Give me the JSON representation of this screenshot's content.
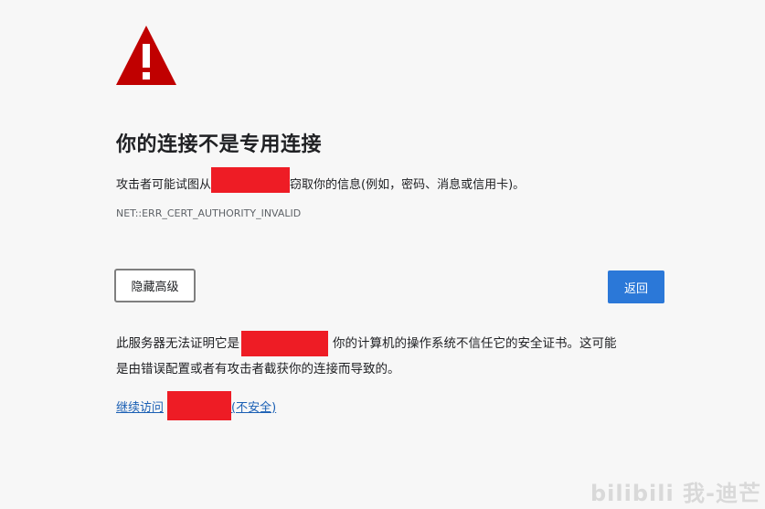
{
  "page": {
    "title": "你的连接不是专用连接",
    "description_before": "攻击者可能试图从",
    "description_after": "窃取你的信息(例如，密码、消息或信用卡)。",
    "error_code": "NET::ERR_CERT_AUTHORITY_INVALID",
    "hide_advanced_label": "隐藏高级",
    "back_label": "返回",
    "explain_line1_before": "此服务器无法证明它是",
    "explain_line1_after": "你的计算机的操作系统不信任它的安全证书。这可能",
    "explain_line2": "是由错误配置或者有攻击者截获你的连接而导致的。",
    "proceed_prefix": "继续访问",
    "proceed_suffix": "(不安全)",
    "watermark": "bilibili 我-迪芒"
  },
  "colors": {
    "warning_red": "#c00000",
    "redaction_red": "#ee1c25",
    "primary_button": "#2b78d8",
    "link": "#1a5fb4"
  },
  "icons": {
    "warning": "warning-triangle-icon"
  }
}
